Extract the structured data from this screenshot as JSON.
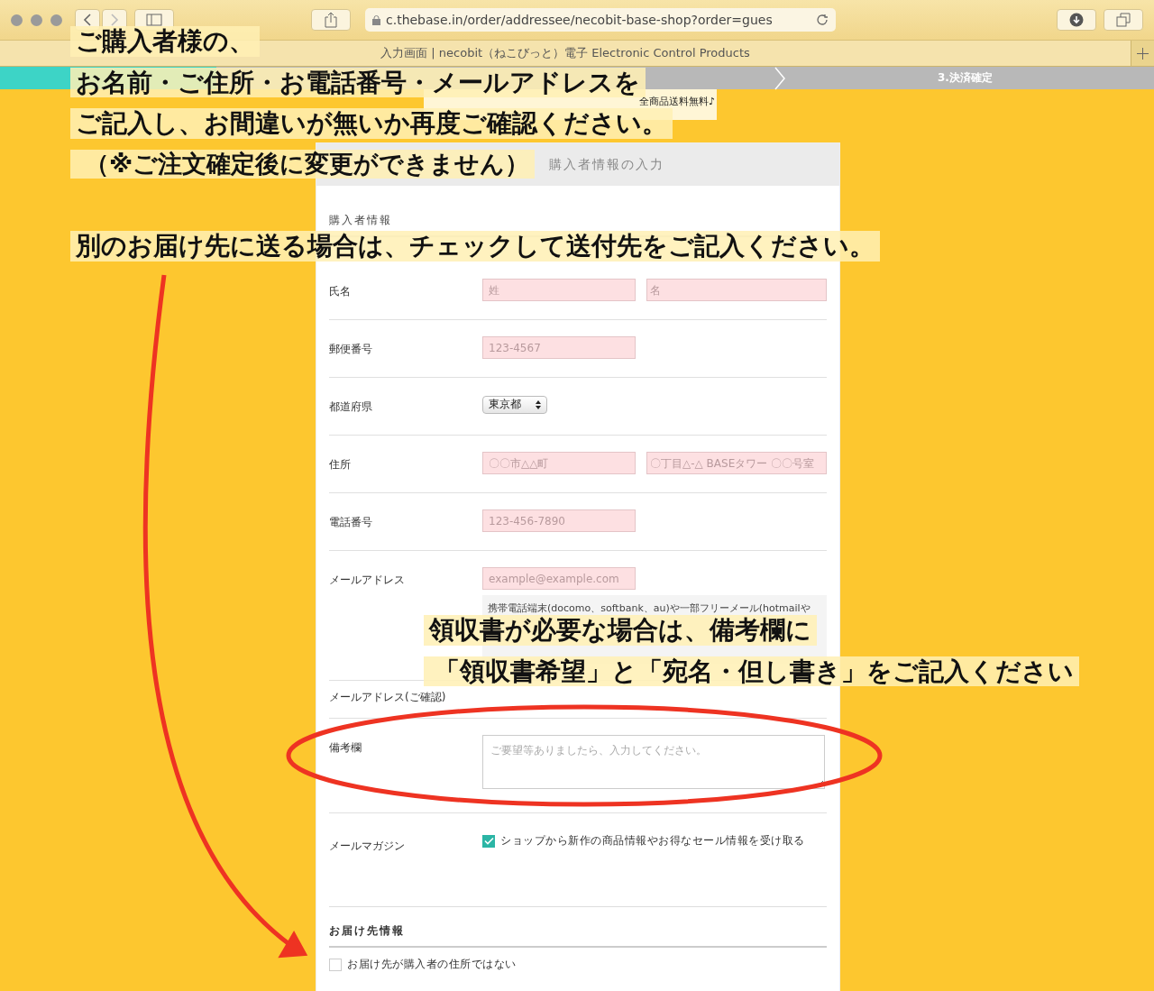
{
  "browser": {
    "url": "c.thebase.in/order/addressee/necobit-base-shop?order=gues",
    "tab_title": "入力画面 | necobit（ねこびっと）電子 Electronic Control Products"
  },
  "steps": [
    {
      "selected": true
    },
    {
      "selected": false
    },
    {
      "label": "3.決済確定",
      "selected": false
    }
  ],
  "banner": {
    "caption": "全商品送料無料♪"
  },
  "card": {
    "title": "購入者情報の入力",
    "section": "購入者情報",
    "rows": [
      {
        "kind": "inputs",
        "label": "氏名",
        "placeholders": [
          "姓",
          "名"
        ]
      },
      {
        "kind": "inputs",
        "label": "郵便番号",
        "placeholders": [
          "123-4567"
        ]
      },
      {
        "kind": "select",
        "label": "都道府県",
        "value": "東京都"
      },
      {
        "kind": "inputs",
        "label": "住所",
        "placeholders": [
          "〇〇市△△町",
          "〇丁目△-△ BASEタワー 〇〇号室"
        ]
      },
      {
        "kind": "inputs",
        "label": "電話番号",
        "placeholders": [
          "123-456-7890"
        ]
      },
      {
        "kind": "inputs",
        "label": "メールアドレス",
        "placeholders": [
          "example@example.com"
        ],
        "note": "携帯電話端末(docomo、softbank、au)や一部フリーメール(hotmailや"
      },
      {
        "kind": "label",
        "label": "メールアドレス(ご確認)"
      },
      {
        "kind": "textarea",
        "label": "備考欄",
        "placeholder": "ご要望等ありましたら、入力してください。"
      },
      {
        "kind": "checkbox",
        "label": "メールマガジン",
        "text": "ショップから新作の商品情報やお得なセール情報を受け取る",
        "checked": true
      }
    ],
    "delivery": {
      "title": "お届け先情報",
      "text": "お届け先が購入者の住所ではない",
      "checked": false
    }
  },
  "annotations": [
    {
      "lines": [
        "ご購入者様の、",
        "お名前・ご住所・お電話番号・メールアドレスを",
        "ご記入し、お間違いが無いか再度ご確認ください。",
        "（※ご注文確定後に変更ができません）",
        "別のお届け先に送る場合は、チェックして送付先をご記入ください。"
      ]
    },
    {
      "lines": [
        "領収書が必要な場合は、備考欄に",
        "「領収書希望」と「宛名・但し書き」をご記入ください"
      ]
    }
  ]
}
